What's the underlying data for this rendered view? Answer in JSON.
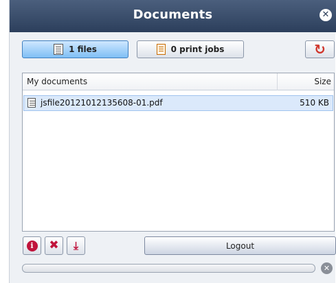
{
  "window": {
    "title": "Documents",
    "close_icon": "close-icon"
  },
  "toolbar": {
    "files_label": "1 files",
    "print_jobs_label": "0 print jobs",
    "files_icon": "document-icon",
    "print_jobs_icon": "print-job-icon",
    "refresh_icon": "refresh-icon",
    "active_tab": "files"
  },
  "list": {
    "columns": [
      "My documents",
      "Size"
    ],
    "rows": [
      {
        "name": "jsfile20121012135608-01.pdf",
        "size": "510 KB",
        "icon": "document-icon",
        "selected": true
      }
    ]
  },
  "footer": {
    "info_icon": "info-icon",
    "delete_icon": "delete-icon",
    "download_icon": "download-icon",
    "logout_label": "Logout",
    "progress": 0,
    "cancel_icon": "cancel-icon"
  },
  "colors": {
    "titlebar": "#2c3f5c",
    "accent_red": "#c0143c",
    "active_tab": "#7fbff5",
    "selection": "#dbe9fb"
  }
}
